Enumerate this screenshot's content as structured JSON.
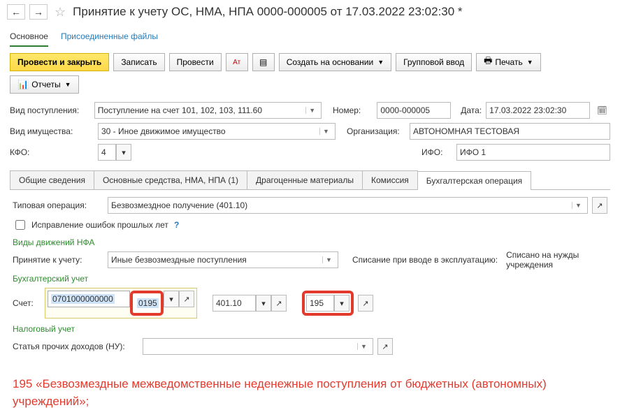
{
  "header": {
    "title": "Принятие к учету ОС, НМА, НПА 0000-000005 от 17.03.2022 23:02:30 *"
  },
  "sections": {
    "main": "Основное",
    "attached": "Присоединенные файлы"
  },
  "actions": {
    "post_close": "Провести и закрыть",
    "save": "Записать",
    "post": "Провести",
    "create_based": "Создать на основании",
    "group_input": "Групповой ввод",
    "print": "Печать",
    "reports": "Отчеты"
  },
  "form": {
    "receipt_type_label": "Вид поступления:",
    "receipt_type_value": "Поступление на счет 101, 102, 103, 111.60",
    "number_label": "Номер:",
    "number_value": "0000-000005",
    "date_label": "Дата:",
    "date_value": "17.03.2022 23:02:30",
    "property_type_label": "Вид имущества:",
    "property_type_value": "30 - Иное движимое имущество",
    "org_label": "Организация:",
    "org_value": "АВТОНОМНАЯ ТЕСТОВАЯ",
    "kfo_label": "КФО:",
    "kfo_value": "4",
    "ifo_label": "ИФО:",
    "ifo_value": "ИФО 1"
  },
  "tabs": {
    "general": "Общие сведения",
    "fixed_assets": "Основные средства, НМА, НПА (1)",
    "precious": "Драгоценные материалы",
    "commission": "Комиссия",
    "accounting": "Бухгалтерская операция"
  },
  "accounting": {
    "typical_op_label": "Типовая операция:",
    "typical_op_value": "Безвозмездное получение (401.10)",
    "correction_label": "Исправление ошибок прошлых лет",
    "nfa_header": "Виды движений НФА",
    "accept_label": "Принятие к учету:",
    "accept_value": "Иные безвозмездные поступления",
    "writeoff_label": "Списание при вводе в эксплуатацию:",
    "writeoff_value": "Списано на нужды учреждения",
    "acc_header": "Бухгалтерский учет",
    "account_label": "Счет:",
    "account1_sel": "0701000000000",
    "account1_tail": "0195",
    "account2": "401.10",
    "account3": "195",
    "tax_header": "Налоговый учет",
    "income_item_label": "Статья прочих доходов (НУ):",
    "income_item_value": ""
  },
  "annotation": "195 «Безвозмездные межведомственные неденежные поступления от бюджетных (автономных) учреждений»;"
}
